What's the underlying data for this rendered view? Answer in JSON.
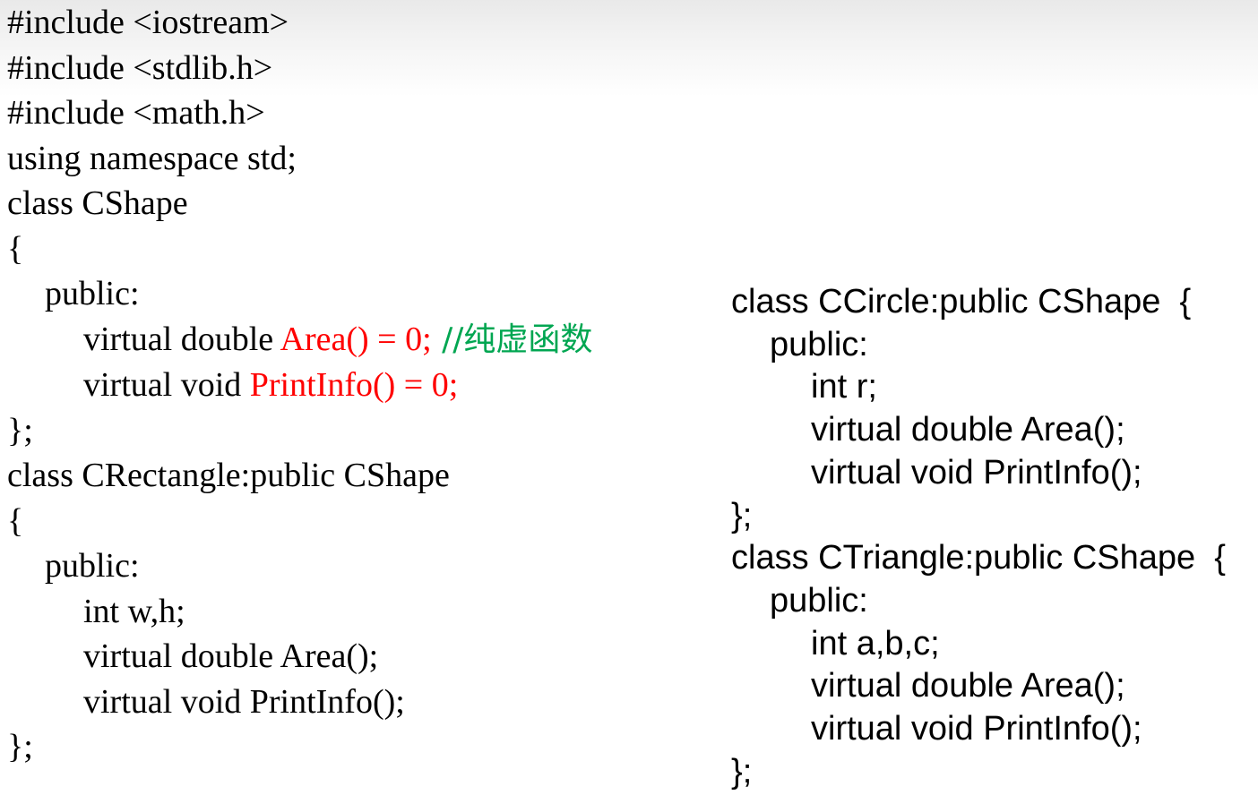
{
  "colors": {
    "text": "#000000",
    "pure_virtual": "#ff0000",
    "comment": "#00a651"
  },
  "left_code": {
    "lines": [
      "#include <iostream>",
      "#include <stdlib.h>",
      "#include <math.h>",
      "using namespace std;",
      "class CShape",
      "{",
      "public:"
    ],
    "area_prefix": "virtual double ",
    "area_pure": "Area() = 0;",
    "area_comment": " //纯虚函数",
    "printinfo_prefix": "virtual void ",
    "printinfo_pure": "PrintInfo() = 0;",
    "close1": "};",
    "rect_class": "class CRectangle:public CShape",
    "rect_open": "{",
    "rect_public": "public:",
    "rect_members": "int w,h;",
    "rect_area": "virtual double Area();",
    "rect_print": "virtual void PrintInfo();",
    "close2": "};"
  },
  "right_code": {
    "circle_class": "class CCircle:public CShape  {",
    "circle_public": "public:",
    "circle_members": "int r;",
    "circle_area": "virtual double Area();",
    "circle_print": "virtual void PrintInfo();",
    "close1": "};",
    "triangle_class": "class CTriangle:public CShape  {",
    "triangle_public": "public:",
    "triangle_members": "int a,b,c;",
    "triangle_area": "virtual double Area();",
    "triangle_print": "virtual void PrintInfo();",
    "close2": "};"
  }
}
